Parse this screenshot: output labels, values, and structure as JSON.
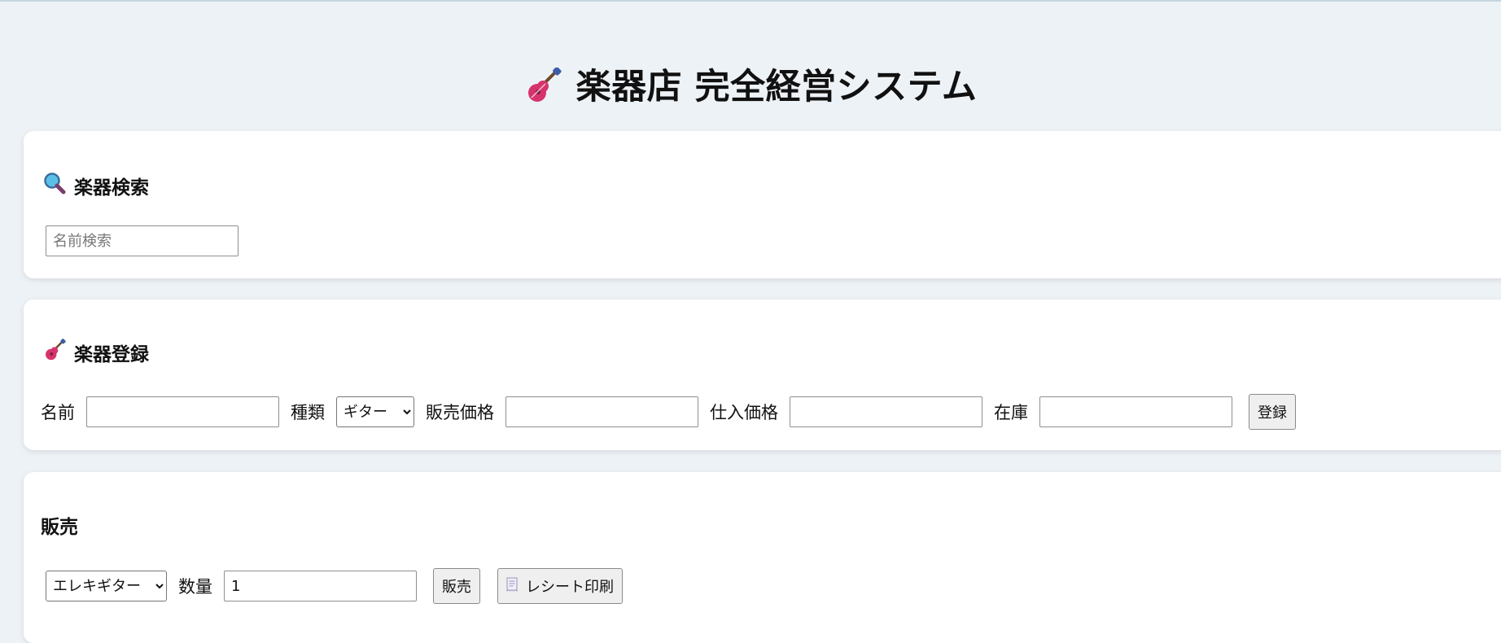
{
  "app": {
    "title": "楽器店 完全経営システム",
    "title_icon": "guitar-icon"
  },
  "search": {
    "title": "楽器検索",
    "title_icon": "magnifier-icon",
    "name_placeholder": "名前検索",
    "name_value": ""
  },
  "register": {
    "title": "楽器登録",
    "title_icon": "guitar-icon",
    "name_label": "名前",
    "name_value": "",
    "type_label": "種類",
    "type_selected": "ギター",
    "sale_price_label": "販売価格",
    "sale_price_value": "",
    "purchase_price_label": "仕入価格",
    "purchase_price_value": "",
    "stock_label": "在庫",
    "stock_value": "",
    "submit_label": "登録"
  },
  "sales": {
    "title": "販売",
    "instrument_selected": "エレキギター",
    "quantity_label": "数量",
    "quantity_value": "1",
    "sell_label": "販売",
    "receipt_label": "レシート印刷",
    "receipt_icon": "receipt-icon"
  },
  "colors": {
    "background": "#edf2f6",
    "card": "#ffffff",
    "button": "#efefef"
  }
}
